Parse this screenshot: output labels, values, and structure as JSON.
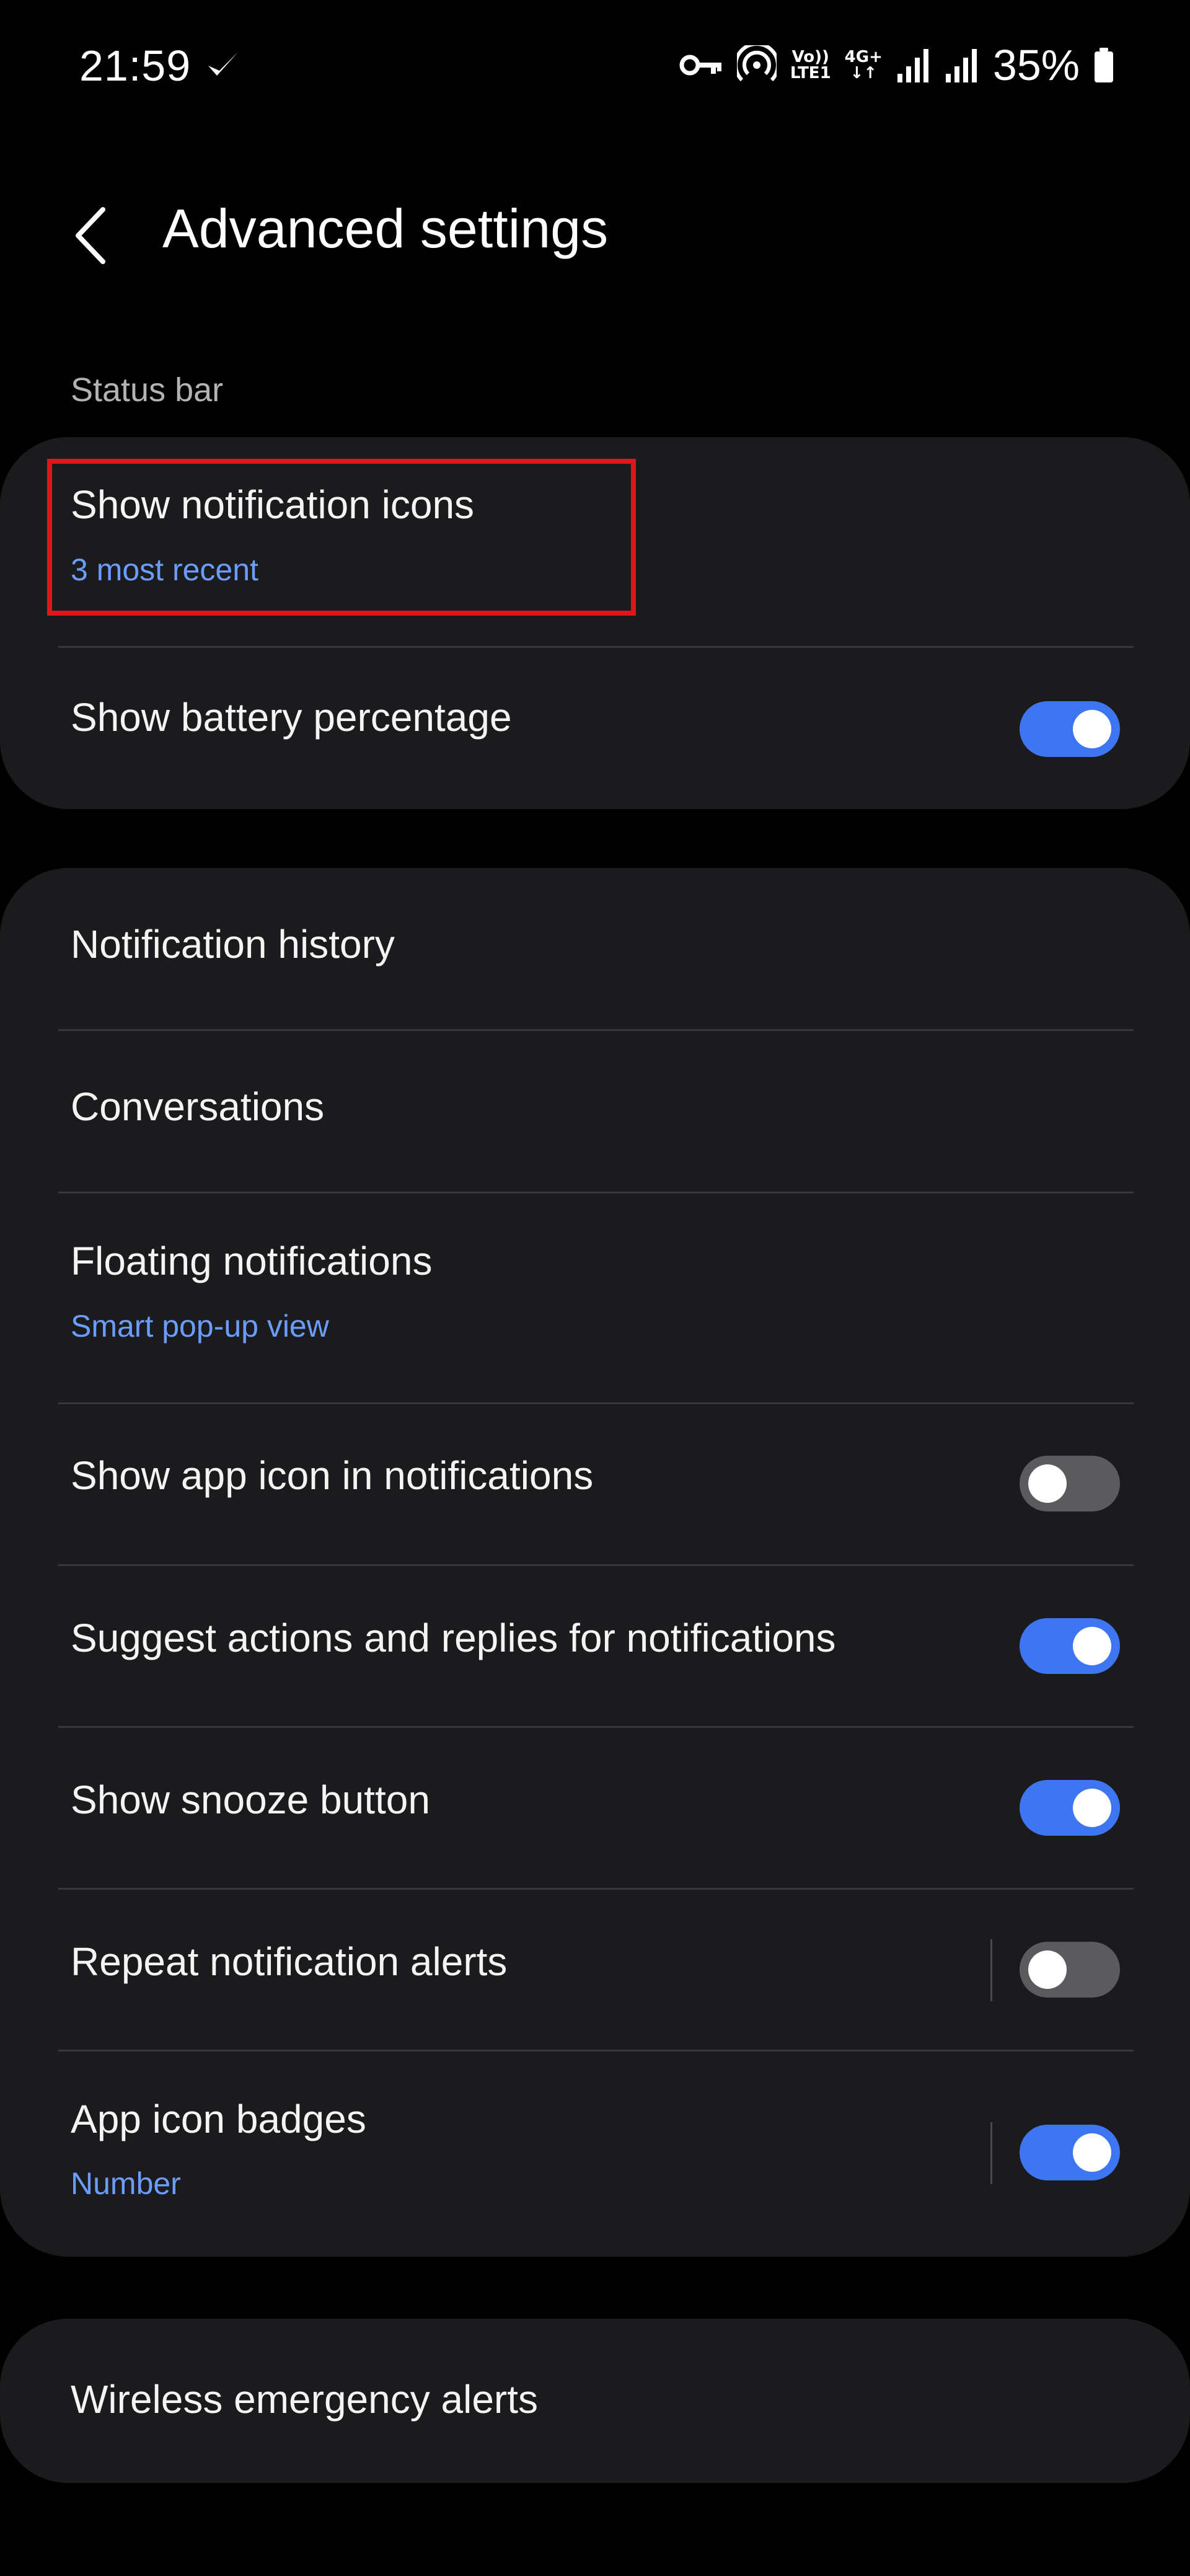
{
  "status_bar": {
    "time": "21:59",
    "volte_top": "Vo))",
    "volte_bottom": "LTE1",
    "network_type": "4G+",
    "network_arrows": "↓↑",
    "battery_percent": "35%",
    "icons": [
      "check-icon",
      "vpn-key-icon",
      "hotspot-icon",
      "signal-icon",
      "signal-icon",
      "battery-icon"
    ]
  },
  "header": {
    "title": "Advanced settings",
    "back_icon": "back-chevron-icon"
  },
  "sections": {
    "status_bar_label": "Status bar"
  },
  "status_bar_card": {
    "notification_icons": {
      "title": "Show notification icons",
      "subtitle": "3 most recent"
    },
    "battery_percentage": {
      "title": "Show battery percentage",
      "enabled": true
    }
  },
  "notifications_card": {
    "history": {
      "title": "Notification history"
    },
    "conversations": {
      "title": "Conversations"
    },
    "floating": {
      "title": "Floating notifications",
      "subtitle": "Smart pop-up view"
    },
    "app_icon": {
      "title": "Show app icon in notifications",
      "enabled": false
    },
    "suggest": {
      "title": "Suggest actions and replies for notifications",
      "enabled": true
    },
    "snooze": {
      "title": "Show snooze button",
      "enabled": true
    },
    "repeat": {
      "title": "Repeat notification alerts",
      "enabled": false
    },
    "badges": {
      "title": "App icon badges",
      "subtitle": "Number",
      "enabled": true
    }
  },
  "emergency_card": {
    "wireless_alerts": {
      "title": "Wireless emergency alerts"
    }
  },
  "colors": {
    "background": "#000000",
    "card": "#1b1b1d",
    "accent": "#3e76f2",
    "subtitle": "#6b9dff",
    "highlight": "#e0141c"
  }
}
